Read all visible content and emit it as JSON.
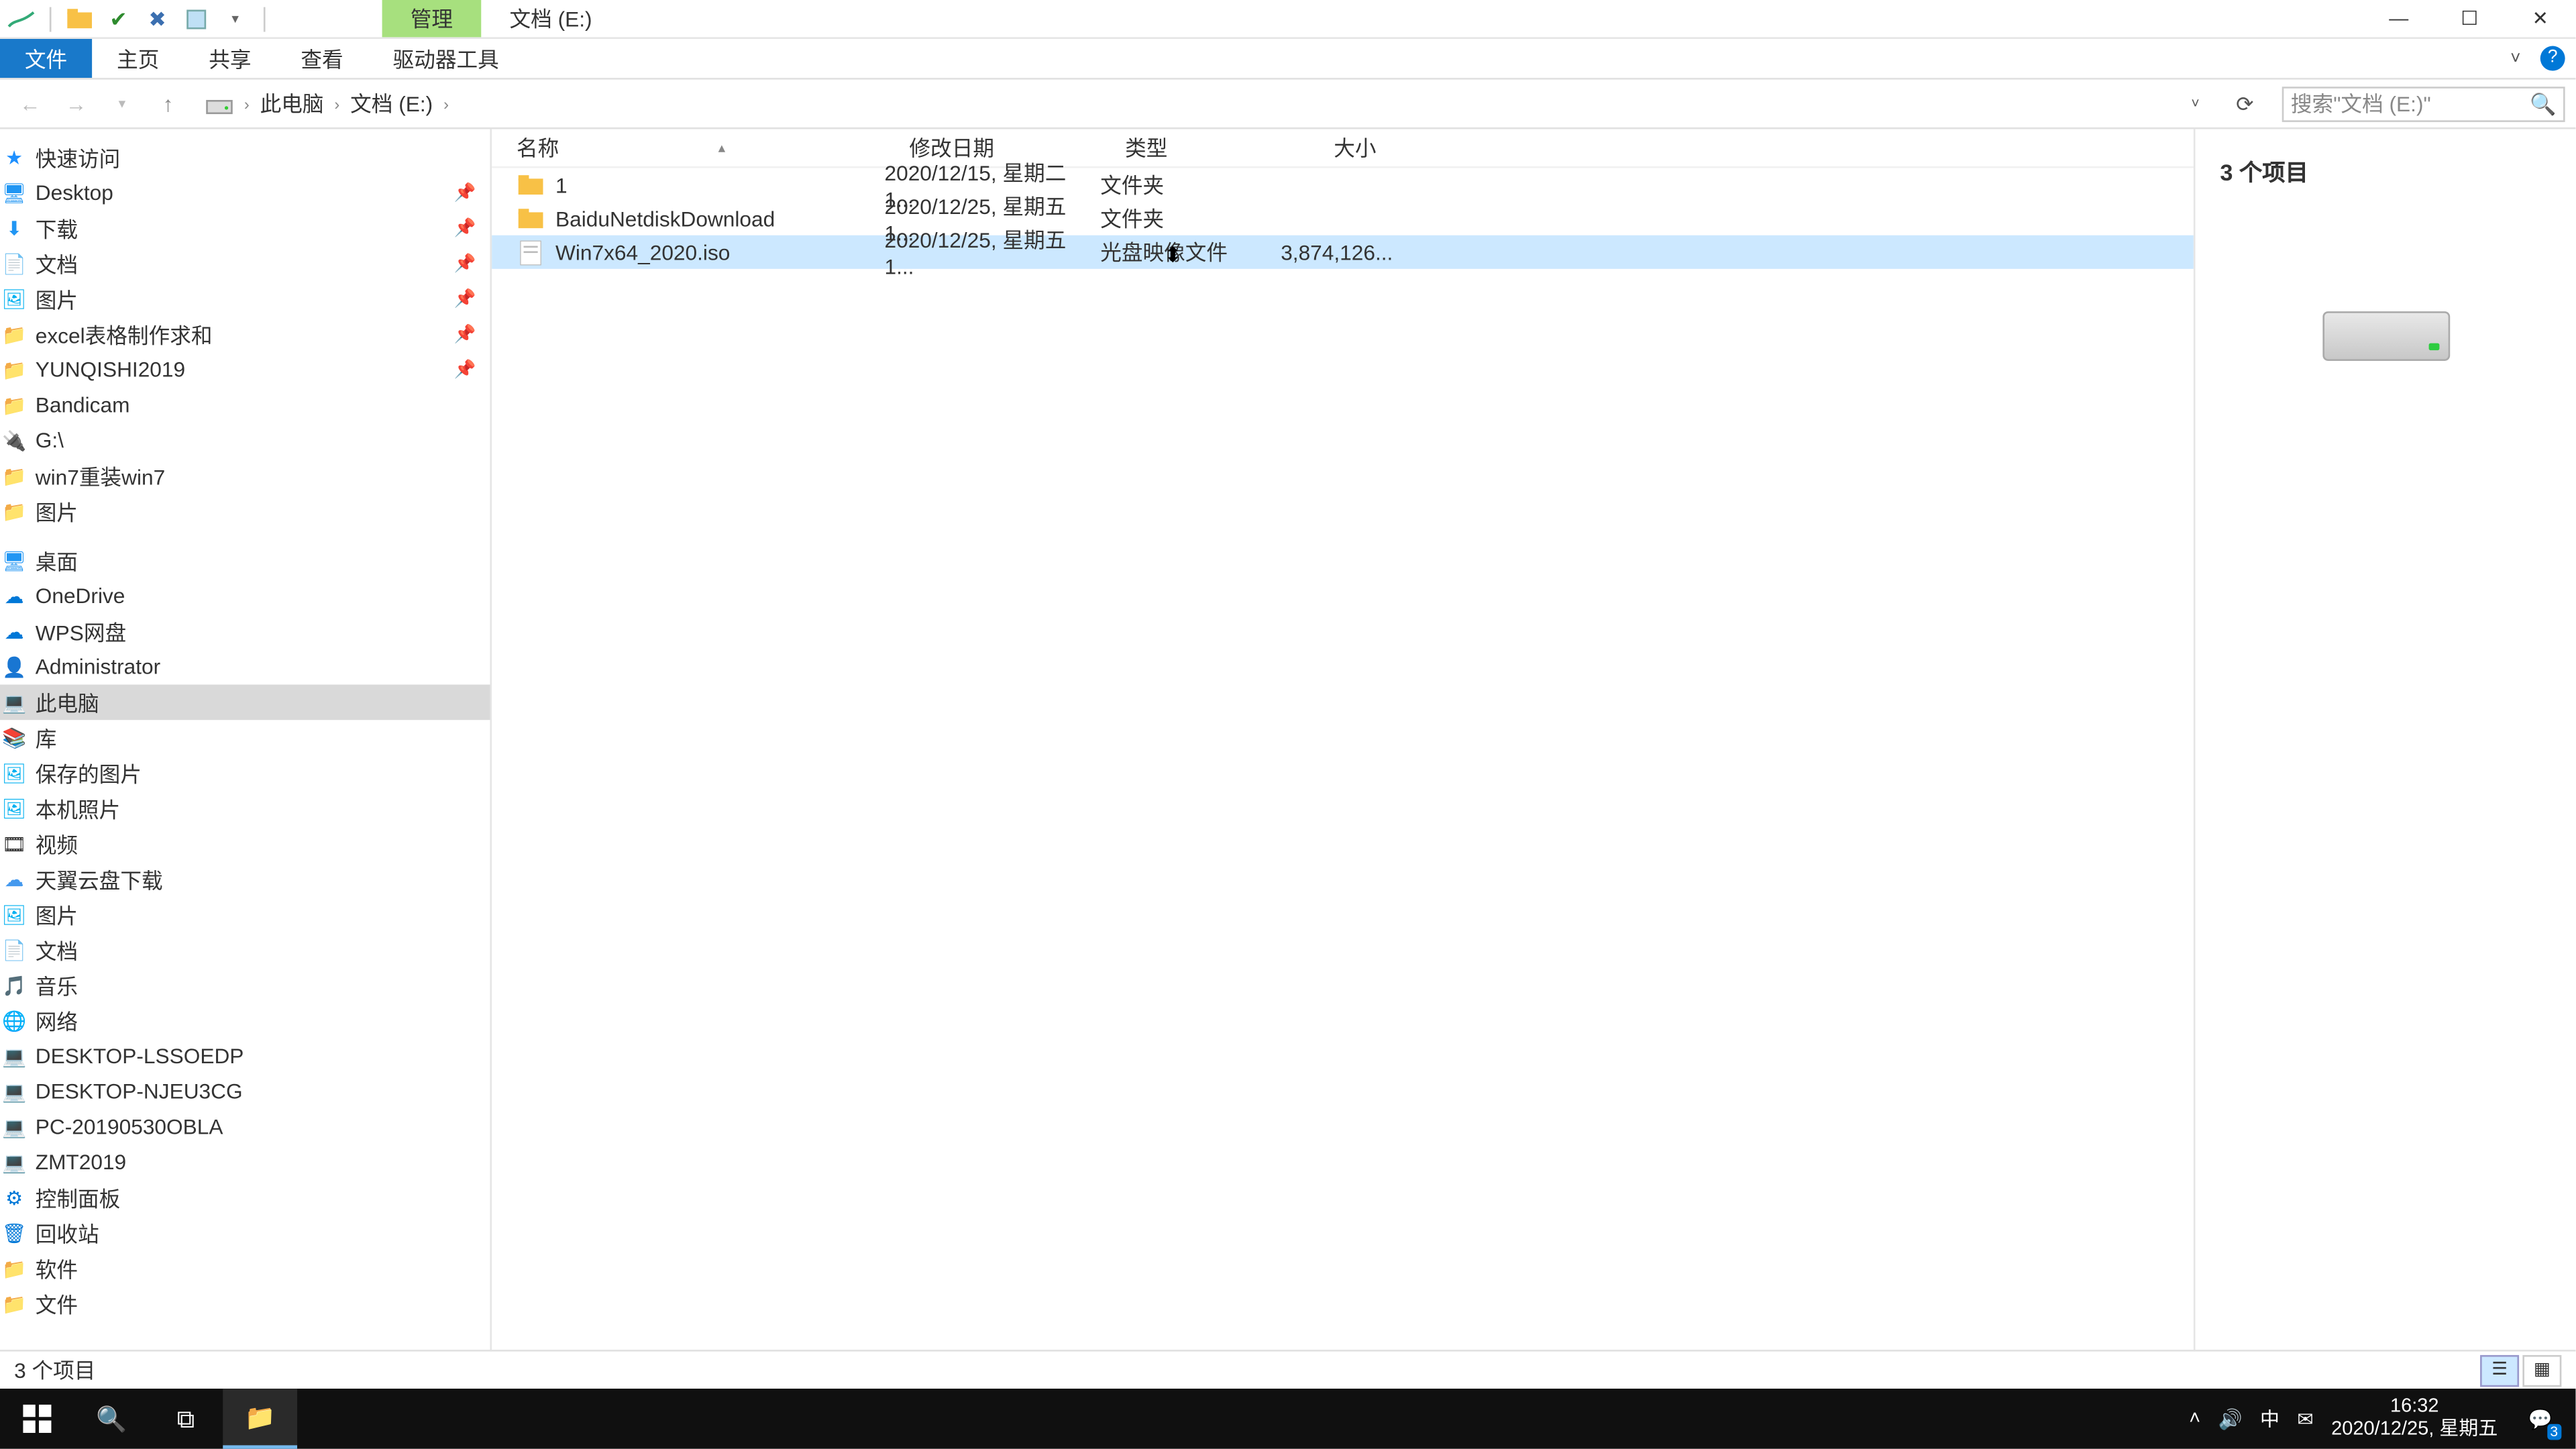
{
  "titlebar": {
    "manage_tab": "管理",
    "location_tab": "文档 (E:)"
  },
  "ribbon": {
    "file": "文件",
    "home": "主页",
    "share": "共享",
    "view": "查看",
    "drive_tools": "驱动器工具"
  },
  "breadcrumb": {
    "pc": "此电脑",
    "drive": "文档 (E:)"
  },
  "search": {
    "placeholder": "搜索\"文档 (E:)\""
  },
  "nav": {
    "quick_access": "快速访问",
    "desktop": "Desktop",
    "downloads": "下载",
    "documents": "文档",
    "pictures": "图片",
    "excel": "excel表格制作求和",
    "yunqishi": "YUNQISHI2019",
    "bandicam": "Bandicam",
    "gdrive": "G:\\",
    "win7reinstall": "win7重装win7",
    "pictures2": "图片",
    "desktop_cn": "桌面",
    "onedrive": "OneDrive",
    "wps": "WPS网盘",
    "admin": "Administrator",
    "this_pc": "此电脑",
    "libraries": "库",
    "saved_pics": "保存的图片",
    "camera_roll": "本机照片",
    "videos": "视频",
    "tianyi": "天翼云盘下载",
    "pics_lib": "图片",
    "docs_lib": "文档",
    "music": "音乐",
    "network": "网络",
    "pc1": "DESKTOP-LSSOEDP",
    "pc2": "DESKTOP-NJEU3CG",
    "pc3": "PC-20190530OBLA",
    "pc4": "ZMT2019",
    "control_panel": "控制面板",
    "recycle": "回收站",
    "software": "软件",
    "files": "文件"
  },
  "columns": {
    "name": "名称",
    "date": "修改日期",
    "type": "类型",
    "size": "大小"
  },
  "rows": [
    {
      "name": "1",
      "date": "2020/12/15, 星期二 1...",
      "type": "文件夹",
      "size": "",
      "icon": "folder"
    },
    {
      "name": "BaiduNetdiskDownload",
      "date": "2020/12/25, 星期五 1...",
      "type": "文件夹",
      "size": "",
      "icon": "folder"
    },
    {
      "name": "Win7x64_2020.iso",
      "date": "2020/12/25, 星期五 1...",
      "type": "光盘映像文件",
      "size": "3,874,126...",
      "icon": "iso",
      "selected": true
    }
  ],
  "preview": {
    "count_label": "3 个项目"
  },
  "status": {
    "text": "3 个项目"
  },
  "tray": {
    "ime": "中",
    "time": "16:32",
    "date": "2020/12/25, 星期五",
    "notif_count": "3"
  }
}
